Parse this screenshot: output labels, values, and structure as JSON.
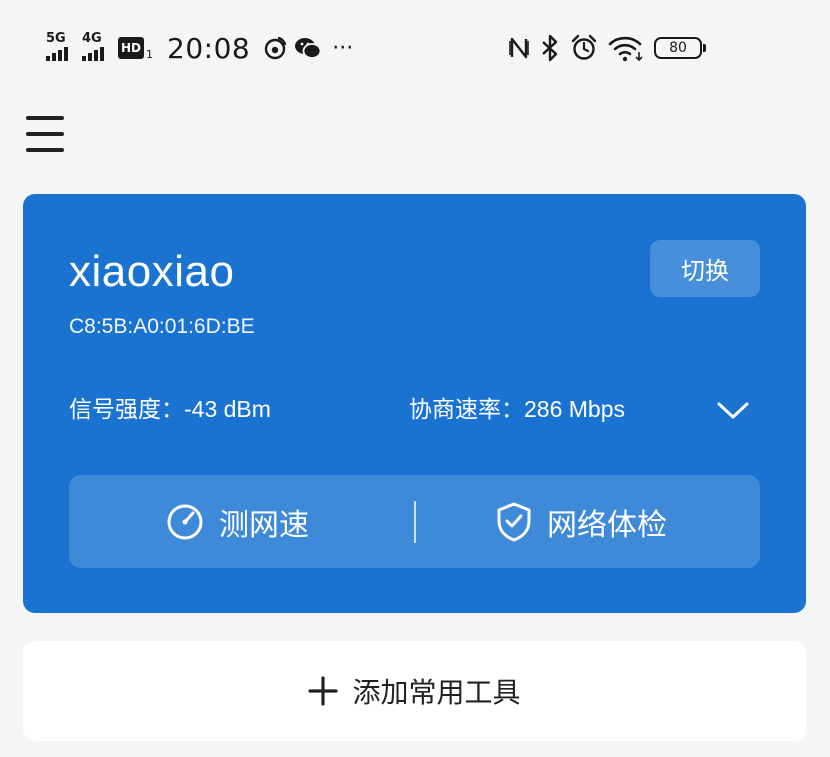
{
  "status_bar": {
    "signal1_gen": "5G",
    "signal2_gen": "4G",
    "hd_badge": "HD",
    "hd_sub": "1",
    "time": "20:08",
    "notif_icons": [
      "weibo-icon",
      "wechat-icon",
      "more-dots-icon"
    ],
    "more_glyph": "···",
    "battery_level": "80"
  },
  "network_card": {
    "ssid": "xiaoxiao",
    "mac": "C8:5B:A0:01:6D:BE",
    "switch_label": "切换",
    "signal_strength": "信号强度：-43 dBm",
    "link_rate": "协商速率：286 Mbps",
    "speed_test_label": "测网速",
    "health_check_label": "网络体检",
    "background_color": "#1a73d1"
  },
  "add_tools": {
    "label": "添加常用工具"
  }
}
